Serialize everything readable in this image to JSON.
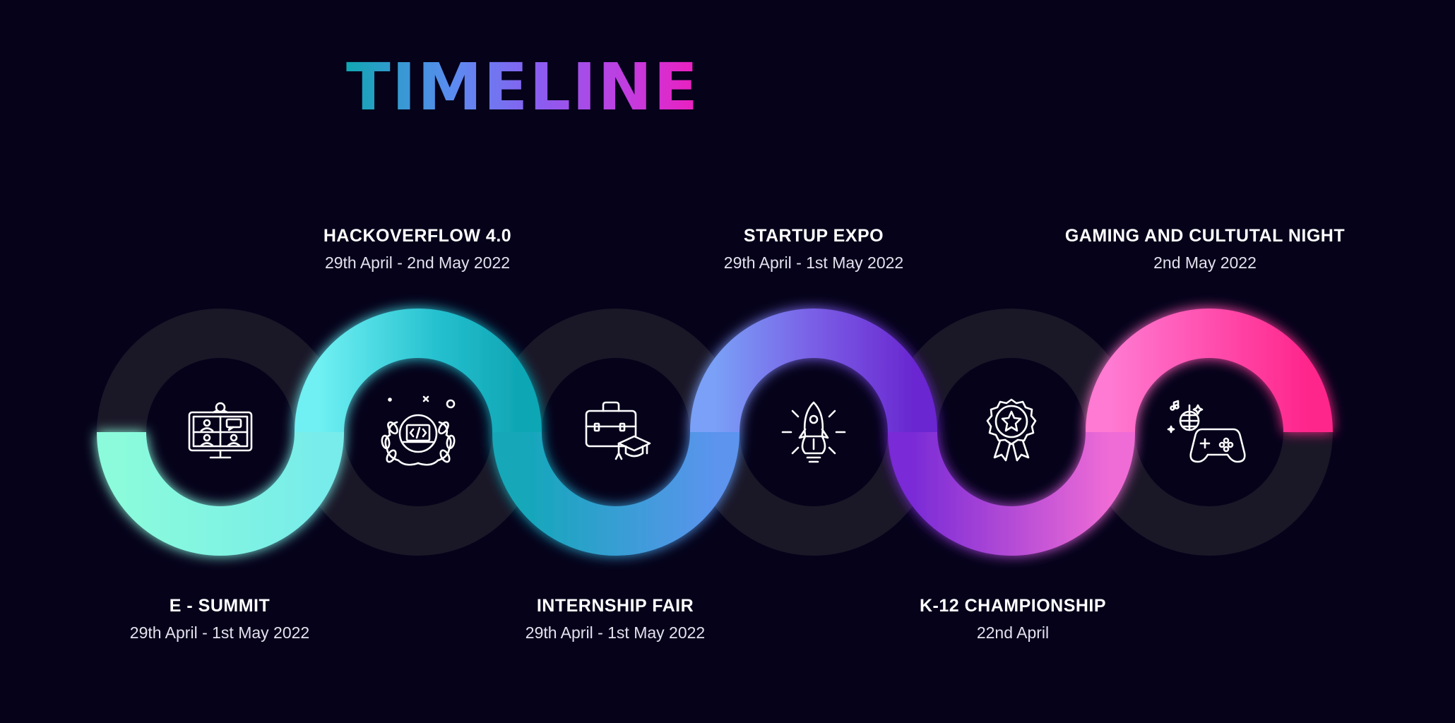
{
  "title": "TIMELINE",
  "events": [
    {
      "name": "E - SUMMIT",
      "date": "29th April - 1st May 2022",
      "icon": "video-conference-icon"
    },
    {
      "name": "HACKOVERFLOW 4.0",
      "date": "29th April - 2nd May 2022",
      "icon": "code-laurel-icon"
    },
    {
      "name": "INTERNSHIP FAIR",
      "date": "29th April - 1st May 2022",
      "icon": "briefcase-graduation-icon"
    },
    {
      "name": "STARTUP EXPO",
      "date": "29th April - 1st May 2022",
      "icon": "rocket-bulb-icon"
    },
    {
      "name": "K-12 CHAMPIONSHIP",
      "date": "22nd April",
      "icon": "award-badge-icon"
    },
    {
      "name": "GAMING AND CULTUTAL NIGHT",
      "date": "2nd May 2022",
      "icon": "gamepad-disco-icon"
    }
  ],
  "colors": {
    "background": "#05021a",
    "track": "#1a1727",
    "gradient": [
      "#8bfbdb",
      "#6ee6f0",
      "#12a8b8",
      "#5b94ee",
      "#8a55e6",
      "#6a28d0",
      "#ff72cf",
      "#ff2890"
    ]
  }
}
